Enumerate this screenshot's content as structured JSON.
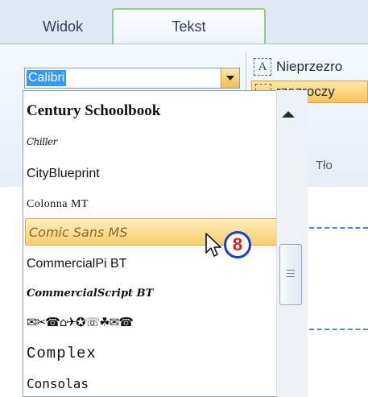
{
  "tabs": {
    "widok": "Widok",
    "tekst": "Tekst"
  },
  "ribbon": {
    "nieprzezroczysty": "Nieprzezro",
    "przezroczysty": "rzezroczy",
    "tlo": "Tło",
    "icon_letter": "A"
  },
  "font_combo": {
    "value": "Calibri"
  },
  "font_list": [
    {
      "label": "Century Schoolbook"
    },
    {
      "label": "Chiller"
    },
    {
      "label": "CityBlueprint"
    },
    {
      "label": "Colonna MT"
    },
    {
      "label": "Comic Sans MS",
      "state": "hover"
    },
    {
      "label": "CommercialPi BT"
    },
    {
      "label": "CommercialScript BT"
    },
    {
      "label": "✉✂☎⌂✈✪☏☘✉☎"
    },
    {
      "label": "Complex"
    },
    {
      "label": "Consolas"
    }
  ],
  "marker": {
    "number": "8"
  },
  "colors": {
    "accent_green": "#8ed17d",
    "hover_gold": "#f8cf6b",
    "selection_blue": "#3399ff",
    "marker_blue": "#1e3cd0",
    "marker_red": "#e11b1b"
  }
}
